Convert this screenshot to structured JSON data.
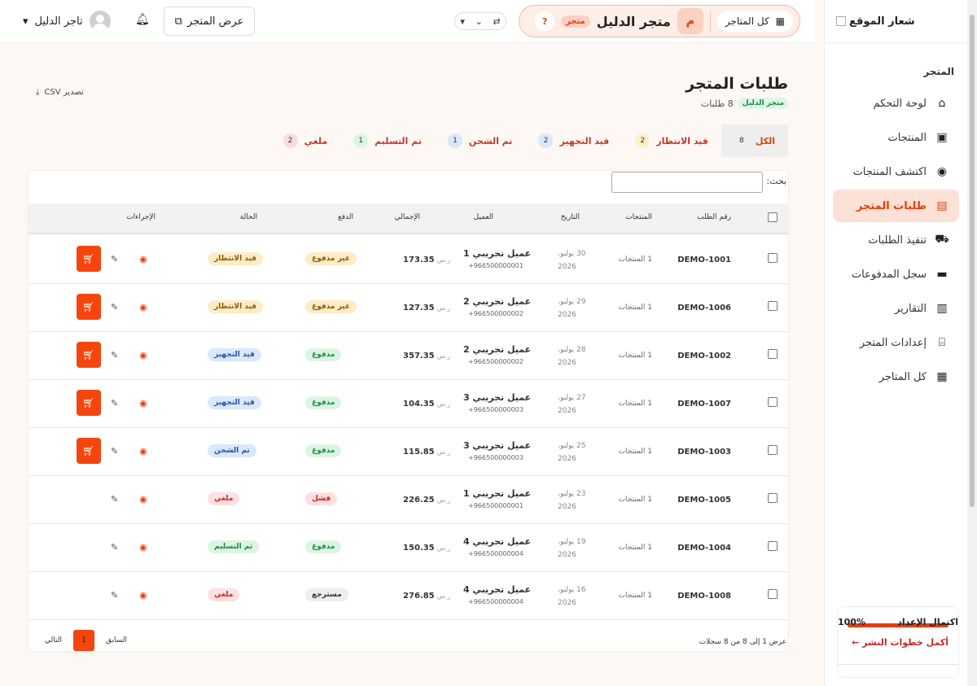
{
  "sidebar": {
    "logo_text": "شعار الموقع",
    "section": "المتجر",
    "items": [
      {
        "label": "لوحة التحكم",
        "icon": "home-icon",
        "glyph": "⌂"
      },
      {
        "label": "المنتجات",
        "icon": "box-icon",
        "glyph": "▣"
      },
      {
        "label": "اكتشف المنتجات",
        "icon": "compass-icon",
        "glyph": "◉"
      },
      {
        "label": "طلبات المتجر",
        "icon": "receipt-icon",
        "glyph": "▤"
      },
      {
        "label": "تنفيذ الطلبات",
        "icon": "truck-icon",
        "glyph": "⛟"
      },
      {
        "label": "سجل المدفوعات",
        "icon": "money-icon",
        "glyph": "▬"
      },
      {
        "label": "التقارير",
        "icon": "bar-chart-icon",
        "glyph": "▥"
      },
      {
        "label": "إعدادات المتجر",
        "icon": "store-icon",
        "glyph": "⌸"
      },
      {
        "label": "كل المتاجر",
        "icon": "grid-icon",
        "glyph": "▦"
      }
    ],
    "setup": {
      "title": "اكتمال الإعداد",
      "percent": "100%",
      "progress": 1.0,
      "link": "أكمل خطوات النشر ←"
    }
  },
  "topbar": {
    "all_stores": "كل المتاجر",
    "store_initial": "م",
    "store_name": "متجر الدليل",
    "store_tag": "متجر",
    "help": "?",
    "view_store": "عرض المتجر",
    "user_name": "تاجر الدليل"
  },
  "page": {
    "title": "طلبات المتجر",
    "store_tag": "متجر الدليل",
    "count_text": "8 طلبات",
    "export": "تصدير CSV"
  },
  "tabs": [
    {
      "label": "الكل",
      "count": "8"
    },
    {
      "label": "قيد الانتظار",
      "count": "2"
    },
    {
      "label": "قيد التجهيز",
      "count": "2"
    },
    {
      "label": "تم الشحن",
      "count": "1"
    },
    {
      "label": "تم التسليم",
      "count": "1"
    },
    {
      "label": "ملغي",
      "count": "2"
    }
  ],
  "table": {
    "search_label": "بحث:",
    "headers": {
      "order": "رقم الطلب",
      "products": "المنتجات",
      "date": "التاريخ",
      "customer": "العميل",
      "total": "الإجمالي",
      "payment": "الدفع",
      "status": "الحالة",
      "actions": "الإجراءات"
    },
    "rows": [
      {
        "order": "DEMO-1001",
        "products": "1 المنتجات",
        "date": "30 يوليو، 2026",
        "customer": "عميل تجريبي 1",
        "phone": "+966500000001",
        "total": "173.35",
        "currency": "ر.س",
        "payment": "غير مدفوع",
        "payment_class": "p-unpaid",
        "status": "قيد الانتظار",
        "status_class": "s-pending",
        "cart": true
      },
      {
        "order": "DEMO-1006",
        "products": "1 المنتجات",
        "date": "29 يوليو، 2026",
        "customer": "عميل تجريبي 2",
        "phone": "+966500000002",
        "total": "127.35",
        "currency": "ر.س",
        "payment": "غير مدفوع",
        "payment_class": "p-unpaid",
        "status": "قيد الانتظار",
        "status_class": "s-pending",
        "cart": true
      },
      {
        "order": "DEMO-1002",
        "products": "1 المنتجات",
        "date": "28 يوليو، 2026",
        "customer": "عميل تجريبي 2",
        "phone": "+966500000002",
        "total": "357.35",
        "currency": "ر.س",
        "payment": "مدفوع",
        "payment_class": "p-paid",
        "status": "قيد التجهيز",
        "status_class": "s-processing",
        "cart": true
      },
      {
        "order": "DEMO-1007",
        "products": "1 المنتجات",
        "date": "27 يوليو، 2026",
        "customer": "عميل تجريبي 3",
        "phone": "+966500000003",
        "total": "104.35",
        "currency": "ر.س",
        "payment": "مدفوع",
        "payment_class": "p-paid",
        "status": "قيد التجهيز",
        "status_class": "s-processing",
        "cart": true
      },
      {
        "order": "DEMO-1003",
        "products": "1 المنتجات",
        "date": "25 يوليو، 2026",
        "customer": "عميل تجريبي 3",
        "phone": "+966500000003",
        "total": "115.85",
        "currency": "ر.س",
        "payment": "مدفوع",
        "payment_class": "p-paid",
        "status": "تم الشحن",
        "status_class": "s-shipped",
        "cart": true
      },
      {
        "order": "DEMO-1005",
        "products": "1 المنتجات",
        "date": "23 يوليو، 2026",
        "customer": "عميل تجريبي 1",
        "phone": "+966500000001",
        "total": "226.25",
        "currency": "ر.س",
        "payment": "فشل",
        "payment_class": "p-failed",
        "status": "ملغي",
        "status_class": "s-cancelled",
        "cart": false
      },
      {
        "order": "DEMO-1004",
        "products": "1 المنتجات",
        "date": "19 يوليو، 2026",
        "customer": "عميل تجريبي 4",
        "phone": "+966500000004",
        "total": "150.35",
        "currency": "ر.س",
        "payment": "مدفوع",
        "payment_class": "p-paid",
        "status": "تم التسليم",
        "status_class": "s-delivered",
        "cart": false
      },
      {
        "order": "DEMO-1008",
        "products": "1 المنتجات",
        "date": "16 يوليو، 2026",
        "customer": "عميل تجريبي 4",
        "phone": "+966500000004",
        "total": "276.85",
        "currency": "ر.س",
        "payment": "مسترجع",
        "payment_class": "p-refunded",
        "status": "ملغي",
        "status_class": "s-cancelled",
        "cart": false
      }
    ],
    "footer_info": "عرض 1 إلى 8 من 8 سجلات",
    "pager": {
      "prev": "السابق",
      "current": "1",
      "next": "التالي"
    }
  },
  "colors": {
    "accent": "#e2400e",
    "accent_button": "#f4450f",
    "active_bg": "#fde0d6"
  }
}
